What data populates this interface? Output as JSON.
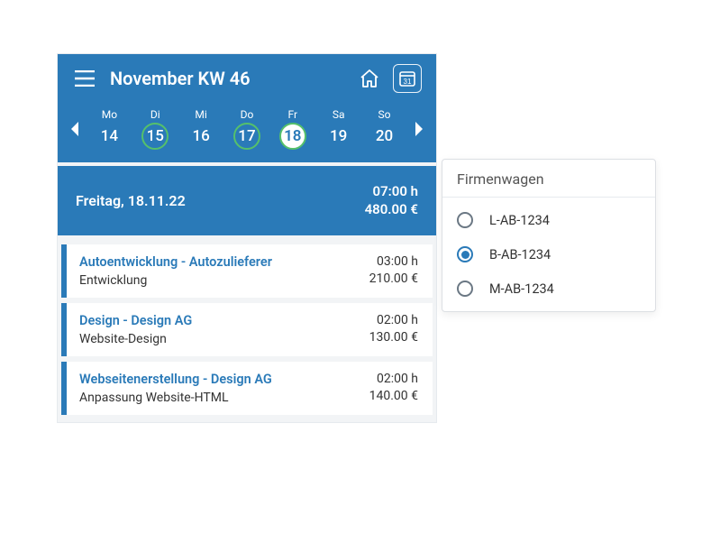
{
  "colors": {
    "primary": "#2a7ab8",
    "accent_green": "#55c06b"
  },
  "header": {
    "title": "November KW 46",
    "calendar_day": "31"
  },
  "week": {
    "days": [
      {
        "dow": "Mo",
        "num": "14",
        "state": ""
      },
      {
        "dow": "Di",
        "num": "15",
        "state": "ring"
      },
      {
        "dow": "Mi",
        "num": "16",
        "state": ""
      },
      {
        "dow": "Do",
        "num": "17",
        "state": "ring"
      },
      {
        "dow": "Fr",
        "num": "18",
        "state": "selected"
      },
      {
        "dow": "Sa",
        "num": "19",
        "state": ""
      },
      {
        "dow": "So",
        "num": "20",
        "state": ""
      }
    ]
  },
  "summary": {
    "date": "Freitag, 18.11.22",
    "hours": "07:00 h",
    "amount": "480.00 €"
  },
  "entries": [
    {
      "title": "Autoentwicklung - Autozulieferer",
      "sub": "Entwicklung",
      "hours": "03:00 h",
      "amount": "210.00 €"
    },
    {
      "title": "Design - Design AG",
      "sub": "Website-Design",
      "hours": "02:00 h",
      "amount": "130.00 €"
    },
    {
      "title": "Webseitenerstellung - Design AG",
      "sub": "Anpassung Website-HTML",
      "hours": "02:00 h",
      "amount": "140.00 €"
    }
  ],
  "popover": {
    "title": "Firmenwagen",
    "options": [
      {
        "label": "L-AB-1234",
        "checked": false
      },
      {
        "label": "B-AB-1234",
        "checked": true
      },
      {
        "label": "M-AB-1234",
        "checked": false
      }
    ]
  }
}
